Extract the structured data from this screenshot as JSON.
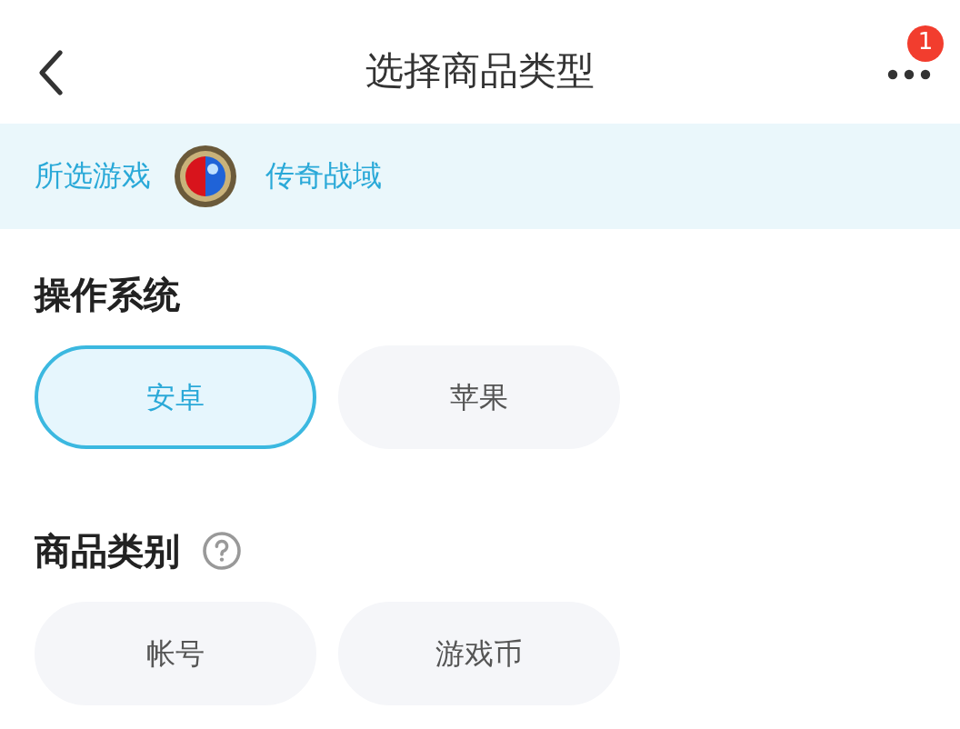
{
  "header": {
    "title": "选择商品类型",
    "badge": "1"
  },
  "game_bar": {
    "label": "所选游戏",
    "game": "传奇战域"
  },
  "sections": [
    {
      "title": "操作系统",
      "help": false,
      "options": [
        {
          "label": "安卓",
          "selected": true
        },
        {
          "label": "苹果",
          "selected": false
        }
      ]
    },
    {
      "title": "商品类别",
      "help": true,
      "options": [
        {
          "label": "帐号",
          "selected": false
        },
        {
          "label": "游戏币",
          "selected": false
        }
      ]
    }
  ]
}
